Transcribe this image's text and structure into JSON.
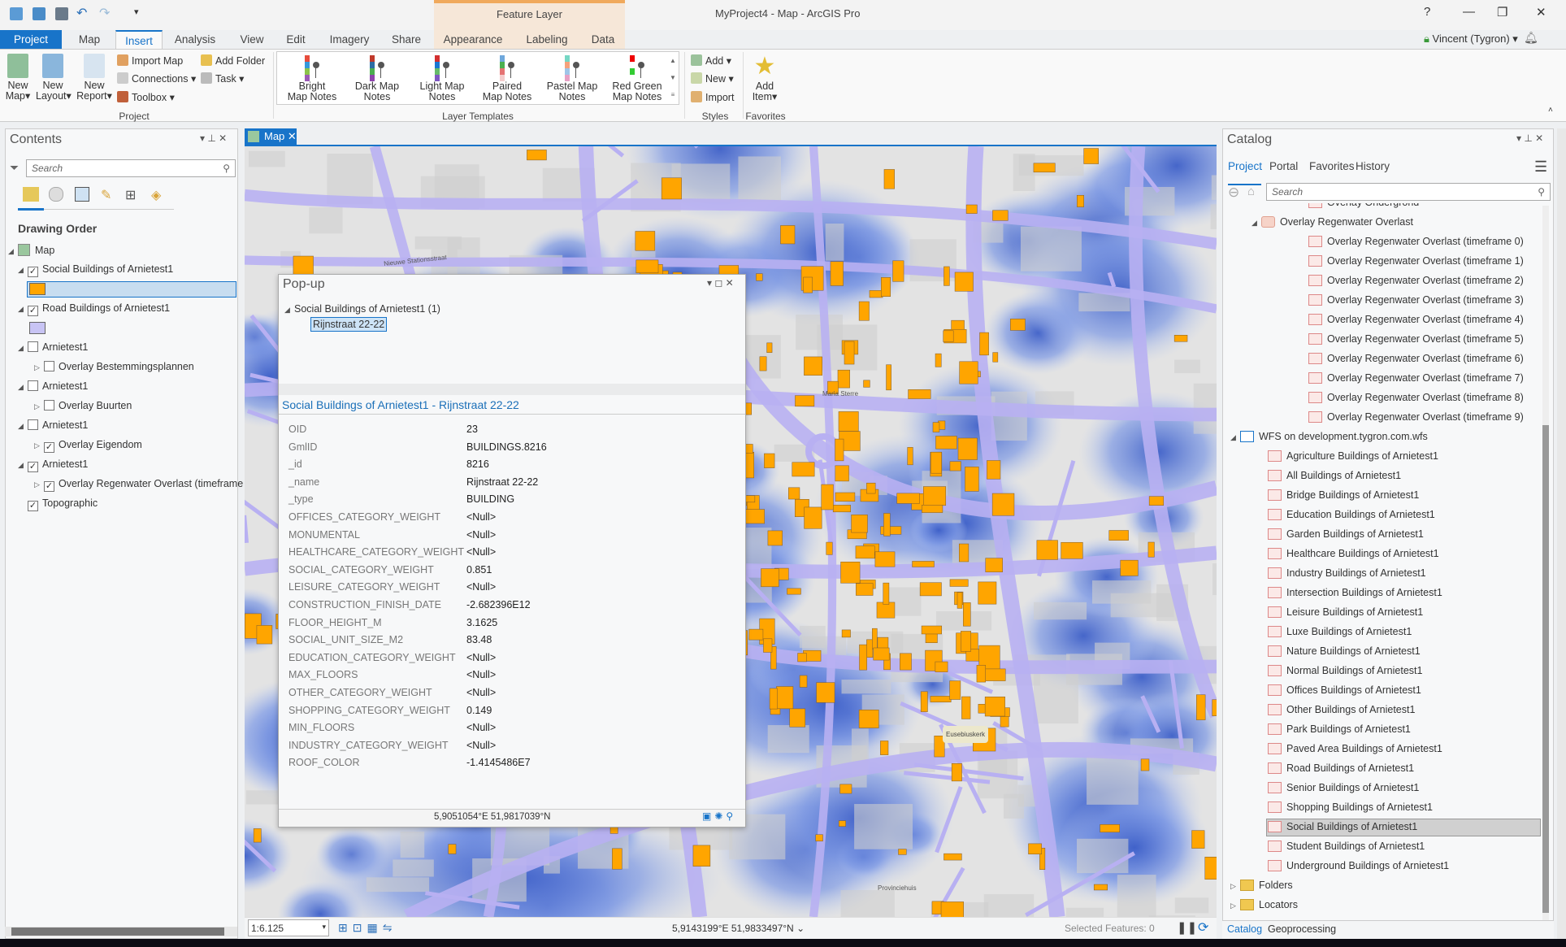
{
  "app": {
    "title": "MyProject4 - Map - ArcGIS Pro",
    "context_tab_group": "Feature Layer",
    "user": "Vincent (Tygron)",
    "help": "?"
  },
  "tabs": [
    "Project",
    "Map",
    "Insert",
    "Analysis",
    "View",
    "Edit",
    "Imagery",
    "Share",
    "Appearance",
    "Labeling",
    "Data"
  ],
  "ribbon": {
    "project_group": {
      "label": "Project",
      "new_map": [
        "New",
        "Map"
      ],
      "new_layout": [
        "New",
        "Layout"
      ],
      "new_report": [
        "New",
        "Report"
      ],
      "import_map": "Import Map",
      "connections": "Connections",
      "toolbox": "Toolbox",
      "add_folder": "Add Folder",
      "task": "Task"
    },
    "layer_templates": {
      "label": "Layer Templates",
      "items": [
        [
          "Bright",
          "Map Notes"
        ],
        [
          "Dark Map",
          "Notes"
        ],
        [
          "Light Map",
          "Notes"
        ],
        [
          "Paired",
          "Map Notes"
        ],
        [
          "Pastel Map",
          "Notes"
        ],
        [
          "Red Green",
          "Map Notes"
        ]
      ]
    },
    "styles": {
      "label": "Styles",
      "add": "Add",
      "new": "New",
      "import": "Import"
    },
    "favorites": {
      "label": "Favorites",
      "add_item": [
        "Add",
        "Item"
      ]
    }
  },
  "contents": {
    "title": "Contents",
    "search_placeholder": "Search",
    "heading": "Drawing Order",
    "items": [
      {
        "label": "Map",
        "level": 0,
        "checkbox": null
      },
      {
        "label": "Social Buildings of Arnietest1",
        "level": 1,
        "checked": true,
        "swatch": "#ffa500"
      },
      {
        "label": "Road Buildings of Arnietest1",
        "level": 1,
        "checked": true,
        "swatch": "#c8c4f4"
      },
      {
        "label": "Arnietest1",
        "level": 1,
        "checked": false
      },
      {
        "label": "Overlay Bestemmingsplannen",
        "level": 2,
        "checked": false
      },
      {
        "label": "Arnietest1",
        "level": 1,
        "checked": false
      },
      {
        "label": "Overlay Buurten",
        "level": 2,
        "checked": false
      },
      {
        "label": "Arnietest1",
        "level": 1,
        "checked": false
      },
      {
        "label": "Overlay Eigendom",
        "level": 2,
        "checked": true
      },
      {
        "label": "Arnietest1",
        "level": 1,
        "checked": true
      },
      {
        "label": "Overlay Regenwater Overlast (timeframe",
        "level": 2,
        "checked": true
      },
      {
        "label": "Topographic",
        "level": 1,
        "checked": true
      }
    ]
  },
  "map": {
    "tab": "Map",
    "scale": "1:6.125",
    "coordinates": "5,9143199°E 51,9833497°N",
    "selected_features": "Selected Features: 0",
    "labels": [
      "Maria Sterre",
      "Eusebiuskerk",
      "Provinciehuis",
      "Nieuwe Stationsstraat"
    ]
  },
  "popup": {
    "title": "Pop-up",
    "layer": "Social Buildings of Arnietest1  (1)",
    "feature": "Rijnstraat 22-22",
    "header": "Social Buildings of Arnietest1 - Rijnstraat 22-22",
    "fields": [
      [
        "OID",
        "23"
      ],
      [
        "GmlID",
        "BUILDINGS.8216"
      ],
      [
        "_id",
        "8216"
      ],
      [
        "_name",
        "Rijnstraat 22-22"
      ],
      [
        "_type",
        "BUILDING"
      ],
      [
        "OFFICES_CATEGORY_WEIGHT",
        "<Null>"
      ],
      [
        "MONUMENTAL",
        "<Null>"
      ],
      [
        "HEALTHCARE_CATEGORY_WEIGHT",
        "<Null>"
      ],
      [
        "SOCIAL_CATEGORY_WEIGHT",
        "0.851"
      ],
      [
        "LEISURE_CATEGORY_WEIGHT",
        "<Null>"
      ],
      [
        "CONSTRUCTION_FINISH_DATE",
        "-2.682396E12"
      ],
      [
        "FLOOR_HEIGHT_M",
        "3.1625"
      ],
      [
        "SOCIAL_UNIT_SIZE_M2",
        "83.48"
      ],
      [
        "EDUCATION_CATEGORY_WEIGHT",
        "<Null>"
      ],
      [
        "MAX_FLOORS",
        "<Null>"
      ],
      [
        "OTHER_CATEGORY_WEIGHT",
        "<Null>"
      ],
      [
        "SHOPPING_CATEGORY_WEIGHT",
        "0.149"
      ],
      [
        "MIN_FLOORS",
        "<Null>"
      ],
      [
        "INDUSTRY_CATEGORY_WEIGHT",
        "<Null>"
      ],
      [
        "ROOF_COLOR",
        "-1.4145486E7"
      ]
    ],
    "coordinates": "5,9051054°E 51,9817039°N"
  },
  "catalog": {
    "title": "Catalog",
    "tabs": [
      "Project",
      "Portal",
      "Favorites",
      "History"
    ],
    "search_placeholder": "Search",
    "items": [
      {
        "label": "Overlay Ondergrond",
        "level": 2
      },
      {
        "label": "Overlay Regenwater Overlast",
        "level": 1,
        "group": true
      },
      {
        "label": "Overlay Regenwater Overlast (timeframe 0)",
        "level": 2
      },
      {
        "label": "Overlay Regenwater Overlast (timeframe 1)",
        "level": 2
      },
      {
        "label": "Overlay Regenwater Overlast (timeframe 2)",
        "level": 2
      },
      {
        "label": "Overlay Regenwater Overlast (timeframe 3)",
        "level": 2
      },
      {
        "label": "Overlay Regenwater Overlast (timeframe 4)",
        "level": 2
      },
      {
        "label": "Overlay Regenwater Overlast (timeframe 5)",
        "level": 2
      },
      {
        "label": "Overlay Regenwater Overlast (timeframe 6)",
        "level": 2
      },
      {
        "label": "Overlay Regenwater Overlast (timeframe 7)",
        "level": 2
      },
      {
        "label": "Overlay Regenwater Overlast (timeframe 8)",
        "level": 2
      },
      {
        "label": "Overlay Regenwater Overlast (timeframe 9)",
        "level": 2
      },
      {
        "label": "WFS on development.tygron.com.wfs",
        "level": 0,
        "server": true
      },
      {
        "label": "Agriculture Buildings of Arnietest1",
        "level": 1
      },
      {
        "label": "All Buildings of Arnietest1",
        "level": 1
      },
      {
        "label": "Bridge Buildings of Arnietest1",
        "level": 1
      },
      {
        "label": "Education Buildings of Arnietest1",
        "level": 1
      },
      {
        "label": "Garden Buildings of Arnietest1",
        "level": 1
      },
      {
        "label": "Healthcare Buildings of Arnietest1",
        "level": 1
      },
      {
        "label": "Industry Buildings of Arnietest1",
        "level": 1
      },
      {
        "label": "Intersection Buildings of Arnietest1",
        "level": 1
      },
      {
        "label": "Leisure Buildings of Arnietest1",
        "level": 1
      },
      {
        "label": "Luxe Buildings of Arnietest1",
        "level": 1
      },
      {
        "label": "Nature Buildings of Arnietest1",
        "level": 1
      },
      {
        "label": "Normal Buildings of Arnietest1",
        "level": 1
      },
      {
        "label": "Offices Buildings of Arnietest1",
        "level": 1
      },
      {
        "label": "Other Buildings of Arnietest1",
        "level": 1
      },
      {
        "label": "Park Buildings of Arnietest1",
        "level": 1
      },
      {
        "label": "Paved Area Buildings of Arnietest1",
        "level": 1
      },
      {
        "label": "Road Buildings of Arnietest1",
        "level": 1
      },
      {
        "label": "Senior Buildings of Arnietest1",
        "level": 1
      },
      {
        "label": "Shopping Buildings of Arnietest1",
        "level": 1
      },
      {
        "label": "Social Buildings of Arnietest1",
        "level": 1,
        "selected": true
      },
      {
        "label": "Student Buildings of Arnietest1",
        "level": 1
      },
      {
        "label": "Underground Buildings of Arnietest1",
        "level": 1
      },
      {
        "label": "Folders",
        "level": 0,
        "folder": true
      },
      {
        "label": "Locators",
        "level": 0,
        "folder": true
      }
    ],
    "bottom_tabs": [
      "Catalog",
      "Geoprocessing"
    ]
  },
  "colors": {
    "accent": "#1874c9",
    "buildings": "#ffa500",
    "roads": "#b8b0f2",
    "water": "#4a72d8"
  }
}
